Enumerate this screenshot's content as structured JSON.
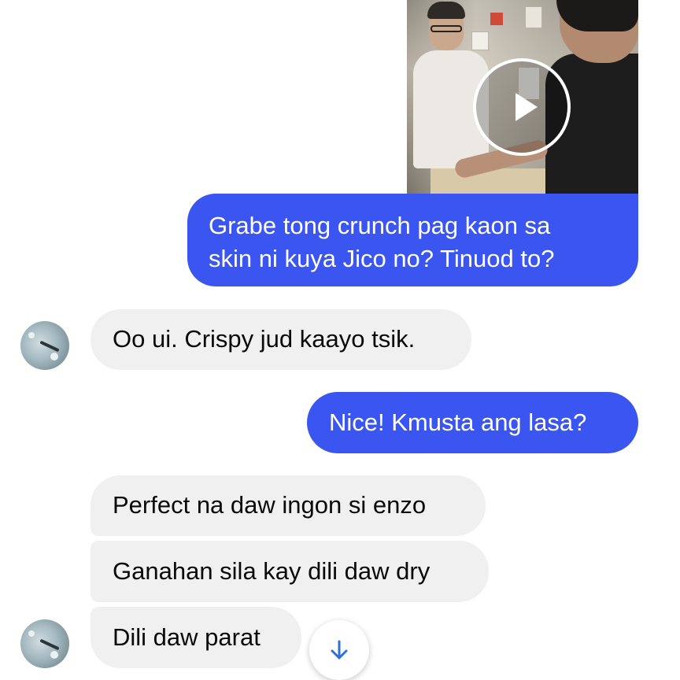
{
  "conversation": {
    "video": {
      "play_icon": "play-icon"
    },
    "messages": [
      {
        "direction": "outgoing",
        "lines": [
          "Grabe tong crunch pag kaon sa",
          "skin ni kuya Jico no? Tinuod to?"
        ]
      },
      {
        "direction": "incoming",
        "text": "Oo ui. Crispy jud kaayo tsik."
      },
      {
        "direction": "outgoing",
        "text": "Nice! Kmusta ang lasa?"
      },
      {
        "direction": "incoming",
        "text": "Perfect na daw ingon si enzo"
      },
      {
        "direction": "incoming",
        "text": "Ganahan sila kay dili daw dry"
      },
      {
        "direction": "incoming",
        "text": "Dili daw parat"
      }
    ],
    "scroll_button_icon": "arrow-down-icon"
  },
  "colors": {
    "outgoing_bubble": "#3b55f0",
    "incoming_bubble": "#f0f0f0",
    "scroll_arrow": "#2f6fd6"
  }
}
